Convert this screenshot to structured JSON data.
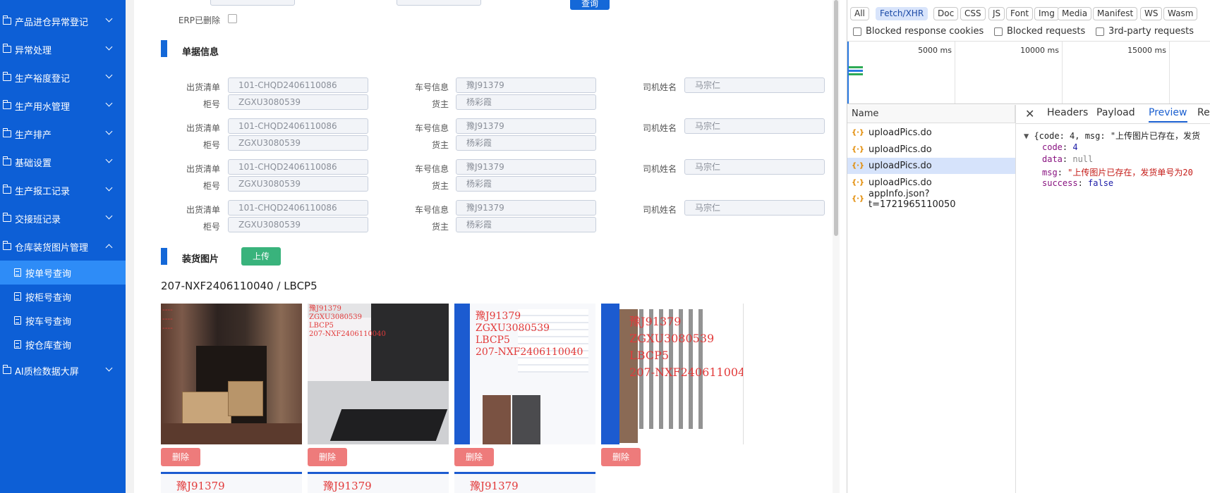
{
  "sidebar": {
    "menu": [
      {
        "label": "产品进仓异常登记",
        "expanded": false
      },
      {
        "label": "异常处理",
        "expanded": false
      },
      {
        "label": "生产裕度登记",
        "expanded": false
      },
      {
        "label": "生产用水管理",
        "expanded": false
      },
      {
        "label": "生产排产",
        "expanded": false
      },
      {
        "label": "基础设置",
        "expanded": false
      },
      {
        "label": "生产报工记录",
        "expanded": false
      },
      {
        "label": "交接班记录",
        "expanded": false
      },
      {
        "label": "仓库装货图片管理",
        "expanded": true
      }
    ],
    "submenu": [
      {
        "label": "按单号查询",
        "active": true
      },
      {
        "label": "按柜号查询",
        "active": false
      },
      {
        "label": "按车号查询",
        "active": false
      },
      {
        "label": "按仓库查询",
        "active": false
      }
    ],
    "last_menu": {
      "label": "AI质检数据大屏",
      "expanded": false
    }
  },
  "search": {
    "erp_deleted_label": "ERP已删除",
    "query_button": "查询"
  },
  "doc_section": {
    "title": "单据信息",
    "rows": [
      {
        "outbound_label": "出货清单",
        "outbound": "101-CHQD2406110086",
        "vehicle_label": "车号信息",
        "vehicle": "豫J91379",
        "driver_label": "司机姓名",
        "driver": "马宗仁",
        "container_label": "柜号",
        "container": "ZGXU3080539",
        "owner_label": "货主",
        "owner": "杨彩霞"
      },
      {
        "outbound_label": "出货清单",
        "outbound": "101-CHQD2406110086",
        "vehicle_label": "车号信息",
        "vehicle": "豫J91379",
        "driver_label": "司机姓名",
        "driver": "马宗仁",
        "container_label": "柜号",
        "container": "ZGXU3080539",
        "owner_label": "货主",
        "owner": "杨彩霞"
      },
      {
        "outbound_label": "出货清单",
        "outbound": "101-CHQD2406110086",
        "vehicle_label": "车号信息",
        "vehicle": "豫J91379",
        "driver_label": "司机姓名",
        "driver": "马宗仁",
        "container_label": "柜号",
        "container": "ZGXU3080539",
        "owner_label": "货主",
        "owner": "杨彩霞"
      },
      {
        "outbound_label": "出货清单",
        "outbound": "101-CHQD2406110086",
        "vehicle_label": "车号信息",
        "vehicle": "豫J91379",
        "driver_label": "司机姓名",
        "driver": "马宗仁",
        "container_label": "柜号",
        "container": "ZGXU3080539",
        "owner_label": "货主",
        "owner": "杨彩霞"
      }
    ]
  },
  "photo_section": {
    "title": "装货图片",
    "upload_button": "上传",
    "group_title": "207-NXF2406110040 / LBCP5",
    "delete_label": "删除",
    "watermarks": [
      "豫J91379",
      "豫J91379\nZGXU3080539\nLBCP5\n207-NXF2406110040"
    ]
  },
  "devtools": {
    "filters": [
      "All",
      "Fetch/XHR",
      "Doc",
      "CSS",
      "JS",
      "Font",
      "Img",
      "Media",
      "Manifest",
      "WS",
      "Wasm"
    ],
    "active_filter": "Fetch/XHR",
    "checkboxes": [
      "Blocked response cookies",
      "Blocked requests",
      "3rd-party requests"
    ],
    "timeline_ticks": [
      "5000 ms",
      "10000 ms",
      "15000 ms"
    ],
    "name_header": "Name",
    "requests": [
      {
        "name": "uploadPics.do",
        "selected": false
      },
      {
        "name": "uploadPics.do",
        "selected": false
      },
      {
        "name": "uploadPics.do",
        "selected": true
      },
      {
        "name": "uploadPics.do",
        "selected": false
      },
      {
        "name": "appInfo.json?t=1721965110050",
        "selected": false
      }
    ],
    "tabs": [
      "Headers",
      "Payload",
      "Preview",
      "Re"
    ],
    "active_tab": "Preview",
    "preview": {
      "summary": "{code: 4, msg: \"上传图片已存在，发货",
      "lines": [
        {
          "key": "code",
          "value": "4",
          "type": "number"
        },
        {
          "key": "data",
          "value": "null",
          "type": "null"
        },
        {
          "key": "msg",
          "value": "\"上传图片已存在，发货单号为20",
          "type": "string"
        },
        {
          "key": "success",
          "value": "false",
          "type": "bool"
        }
      ]
    }
  }
}
